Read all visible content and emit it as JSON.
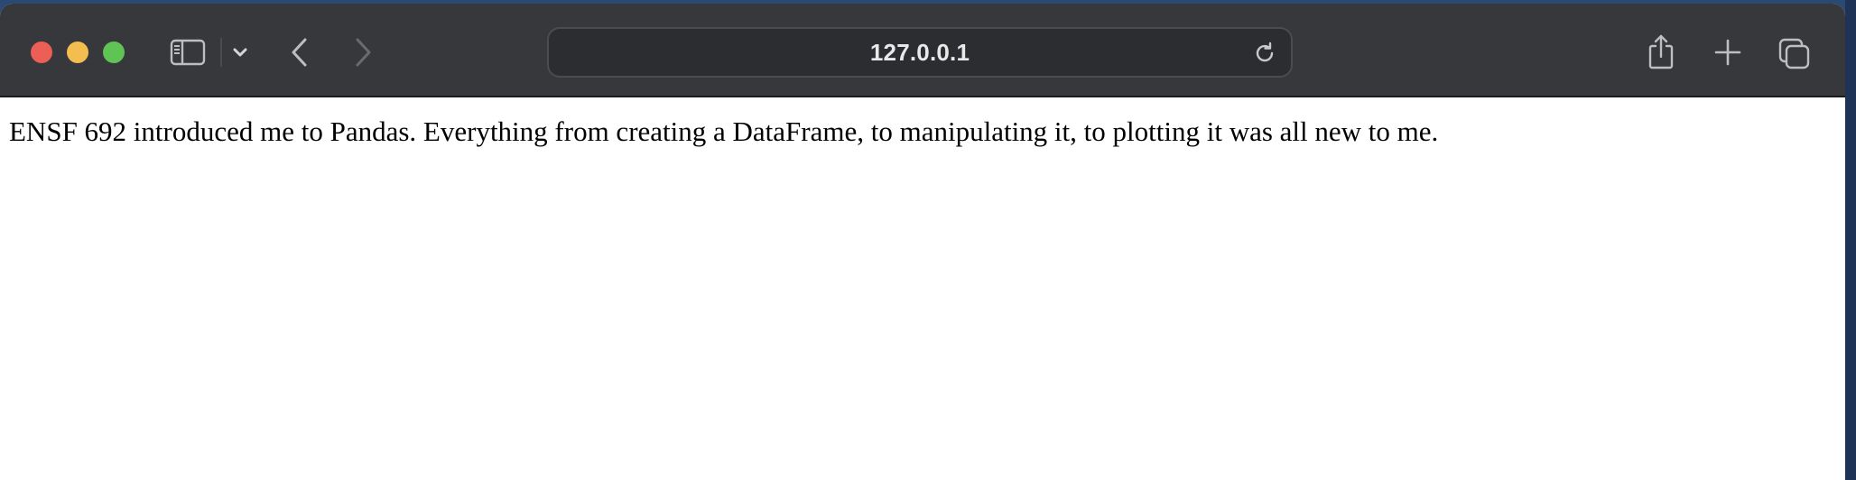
{
  "browser": {
    "url": "127.0.0.1",
    "buttons": {
      "sidebar": "sidebar-icon",
      "tab_group_menu": "chevron-down-icon",
      "back": "chevron-left-icon",
      "forward": "chevron-right-icon",
      "reload": "reload-icon",
      "share": "share-icon",
      "new_tab": "plus-icon",
      "tab_overview": "tabs-overview-icon"
    },
    "colors": {
      "toolbar": "#37383b",
      "close": "#ec5f56",
      "minimize": "#f4bd4f",
      "maximize": "#5fc454"
    }
  },
  "page": {
    "text": "ENSF 692 introduced me to Pandas. Everything from creating a DataFrame, to manipulating it, to plotting it was all new to me."
  }
}
